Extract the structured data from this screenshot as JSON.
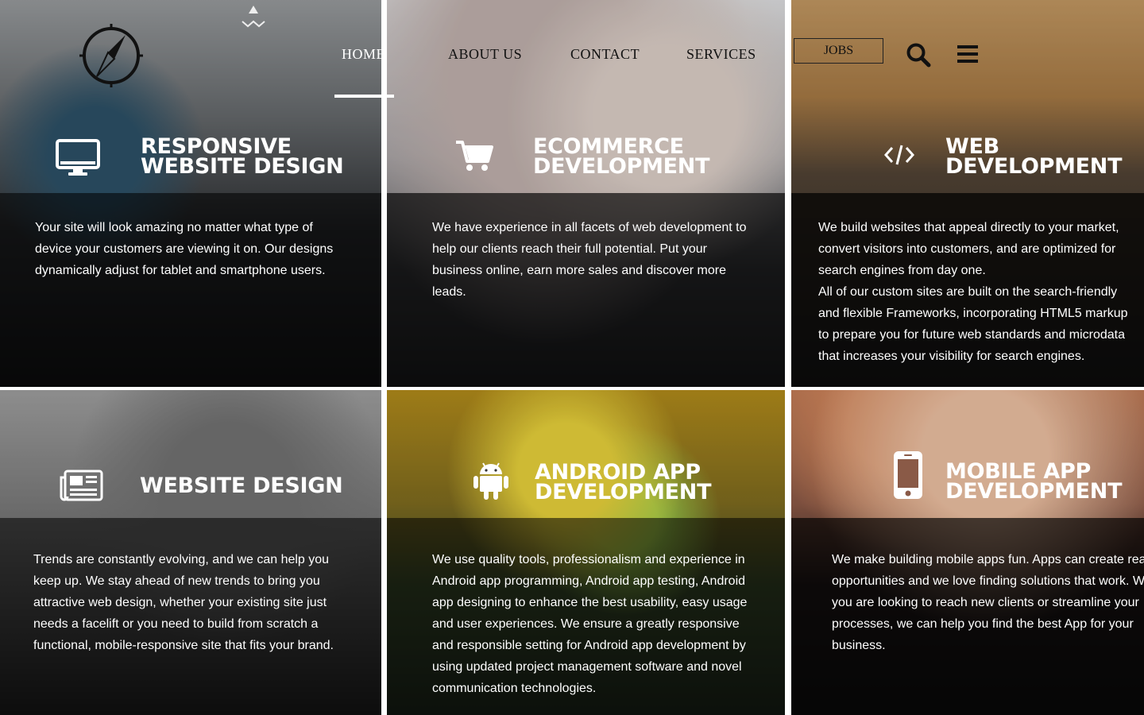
{
  "nav": {
    "items": [
      "HOME",
      "ABOUT US",
      "CONTACT",
      "SERVICES"
    ],
    "jobs": "JOBS"
  },
  "icons": {
    "logo": "compass-logo",
    "search": "search-icon",
    "menu": "hamburger-menu-icon"
  },
  "services": [
    {
      "title": [
        "RESPONSIVE",
        "WEBSITE DESIGN"
      ],
      "icon": "monitor-icon",
      "desc": "Your site will look amazing no matter what type of device your customers are viewing it on. Our designs dynamically adjust for tablet and smartphone users."
    },
    {
      "title": [
        "ECOMMERCE",
        "DEVELOPMENT"
      ],
      "icon": "cart-icon",
      "desc": "We have experience in all facets of web development to help our clients reach their full potential. Put your business online, earn more sales and discover more leads."
    },
    {
      "title": [
        "WEB",
        "DEVELOPMENT"
      ],
      "icon": "code-icon",
      "desc": "We build websites that appeal directly to your market, convert visitors into customers, and are optimized for search engines from day one.",
      "desc2": "All of our custom sites are built on the search-friendly and flexible Frameworks, incorporating HTML5 markup to prepare you for future web standards and microdata that increases your visibility for search engines."
    },
    {
      "title": [
        "WEBSITE DESIGN"
      ],
      "icon": "newspaper-icon",
      "desc": "Trends are constantly evolving, and we can help you keep up. We stay ahead of new trends to bring you attractive web design, whether your existing site just needs a facelift or you need to build from scratch a functional, mobile-responsive site that fits your brand."
    },
    {
      "title": [
        "ANDROID APP",
        "DEVELOPMENT"
      ],
      "icon": "android-icon",
      "desc": "We use quality tools, professionalism and experience in Android app programming, Android app testing, Android app designing to enhance the best usability, easy usage and user experiences. We ensure a greatly responsive and responsible setting for Android app development by using updated project management software and novel communication technologies."
    },
    {
      "title": [
        "MOBILE APP",
        "DEVELOPMENT"
      ],
      "icon": "mobile-phone-icon",
      "desc": "We make building mobile apps fun. Apps can create real opportunities and we love finding solutions that work. Whether you are looking to reach new clients or streamline your processes, we can help you find the best App for your business."
    }
  ]
}
